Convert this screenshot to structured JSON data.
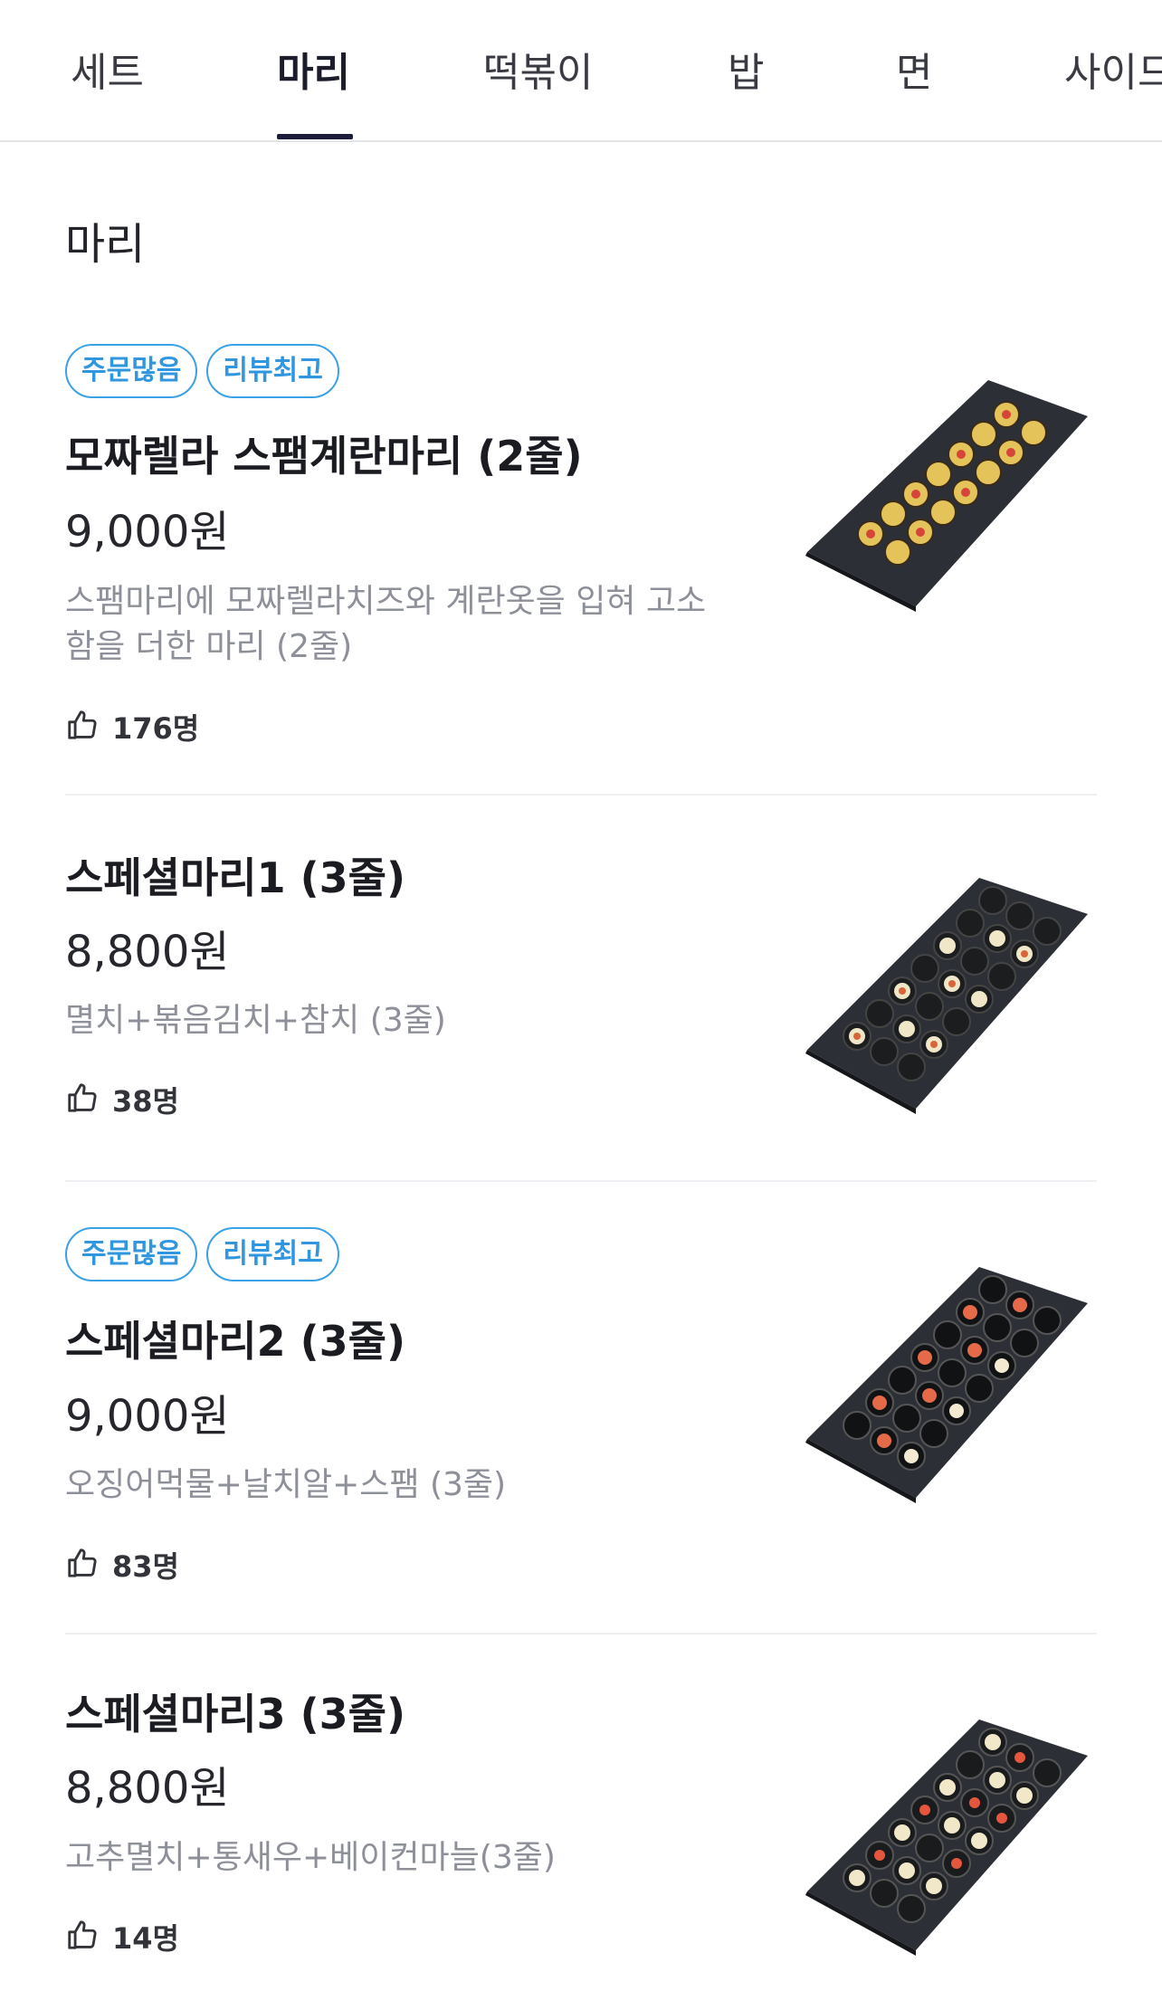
{
  "tabs": [
    {
      "label": "세트",
      "active": false
    },
    {
      "label": "마리",
      "active": true
    },
    {
      "label": "떡볶이",
      "active": false
    },
    {
      "label": "밥",
      "active": false
    },
    {
      "label": "면",
      "active": false
    },
    {
      "label": "사이드",
      "active": false
    }
  ],
  "section_title": "마리",
  "items": [
    {
      "badges": [
        "주문많음",
        "리뷰최고"
      ],
      "name": "모짜렐라 스팸계란마리 (2줄)",
      "price": "9,000원",
      "description": "스팸마리에 모짜렐라치즈와 계란옷을 입혀 고소함을 더한 마리 (2줄)",
      "likes": "176명",
      "image": "mozzarella-spam-egg-roll-platter"
    },
    {
      "badges": [],
      "name": "스페셜마리1 (3줄)",
      "price": "8,800원",
      "description": "멸치+볶음김치+참치 (3줄)",
      "likes": "38명",
      "image": "special-roll-1-platter"
    },
    {
      "badges": [
        "주문많음",
        "리뷰최고"
      ],
      "name": "스페셜마리2 (3줄)",
      "price": "9,000원",
      "description": "오징어먹물+날치알+스팸 (3줄)",
      "likes": "83명",
      "image": "special-roll-2-platter"
    },
    {
      "badges": [],
      "name": "스페셜마리3 (3줄)",
      "price": "8,800원",
      "description": "고추멸치+통새우+베이컨마늘(3줄)",
      "likes": "14명",
      "image": "special-roll-3-platter"
    }
  ],
  "colors": {
    "accent_badge": "#3aa1e6",
    "tab_indicator": "#1c1d3a",
    "description": "#8e9099"
  }
}
